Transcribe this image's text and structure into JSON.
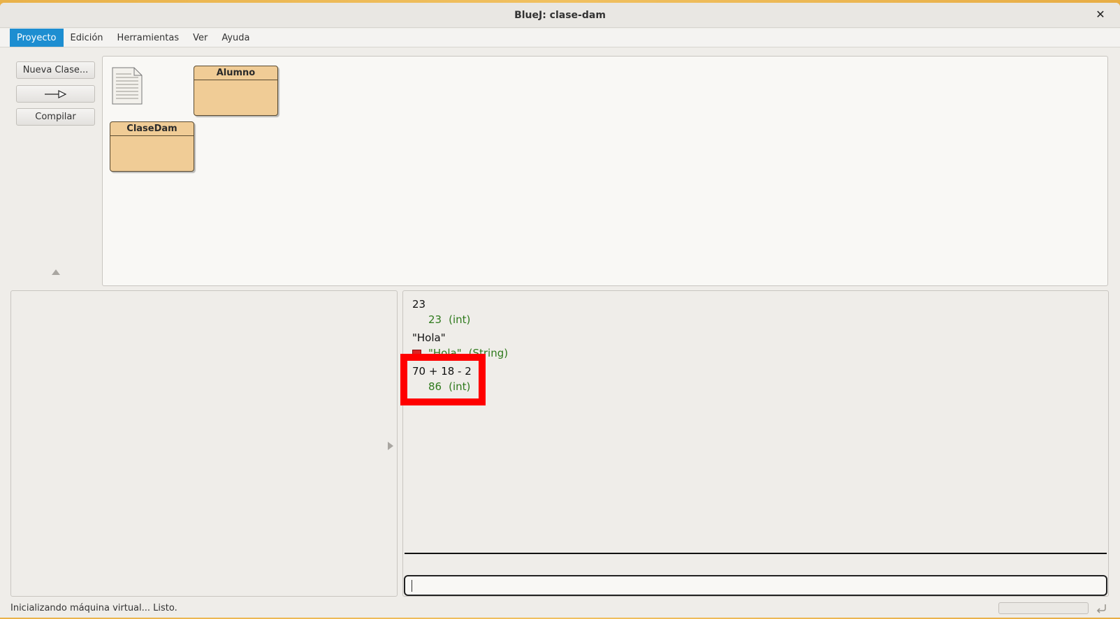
{
  "window": {
    "title": "BlueJ: clase-dam"
  },
  "menu": [
    {
      "label": "Proyecto",
      "active": true
    },
    {
      "label": "Edición",
      "active": false
    },
    {
      "label": "Herramientas",
      "active": false
    },
    {
      "label": "Ver",
      "active": false
    },
    {
      "label": "Ayuda",
      "active": false
    }
  ],
  "toolbar": {
    "new_class": "Nueva Clase...",
    "inherit_arrow_icon": "arrow-right-icon",
    "compile": "Compilar"
  },
  "diagram": {
    "readme_icon": "document-icon",
    "classes": [
      {
        "name": "Alumno"
      },
      {
        "name": "ClaseDam"
      }
    ]
  },
  "codepad": {
    "entries": [
      {
        "expr": "23",
        "value": "23",
        "type": "(int)"
      },
      {
        "expr": "\"Hola\"",
        "value": "\"Hola\"",
        "type": "(String)",
        "object": true
      },
      {
        "expr": "70 + 18 - 2",
        "value": "86",
        "type": "(int)",
        "highlighted": true
      }
    ],
    "input_value": ""
  },
  "status": {
    "text": "Inicializando máquina virtual... Listo."
  },
  "colors": {
    "accent": "#1d8ed1",
    "class_fill": "#f0cc96",
    "result_text": "#2f7a1d",
    "highlight": "#ff0000"
  }
}
